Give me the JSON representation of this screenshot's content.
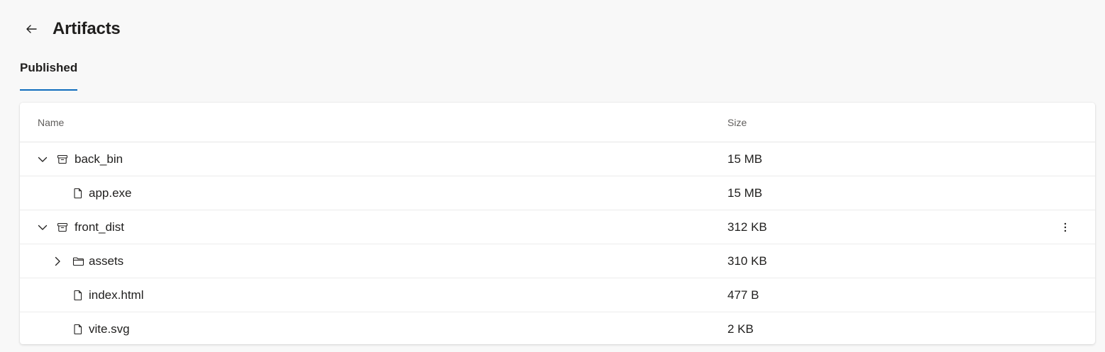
{
  "header": {
    "title": "Artifacts",
    "back_icon": "arrow-left-icon"
  },
  "tabs": [
    {
      "label": "Published",
      "active": true
    }
  ],
  "table": {
    "columns": {
      "name": "Name",
      "size": "Size"
    },
    "rows": [
      {
        "name": "back_bin",
        "size": "15 MB",
        "type": "archive",
        "level": 0,
        "expanded": true
      },
      {
        "name": "app.exe",
        "size": "15 MB",
        "type": "file",
        "level": 1
      },
      {
        "name": "front_dist",
        "size": "312 KB",
        "type": "archive",
        "level": 0,
        "expanded": true,
        "has_menu": true
      },
      {
        "name": "assets",
        "size": "310 KB",
        "type": "folder",
        "level": 1,
        "expanded": false
      },
      {
        "name": "index.html",
        "size": "477 B",
        "type": "file",
        "level": 1
      },
      {
        "name": "vite.svg",
        "size": "2 KB",
        "type": "file",
        "level": 1
      }
    ]
  },
  "colors": {
    "accent": "#0f6cbd",
    "background": "#f8f8f8",
    "card": "#ffffff",
    "text": "#201f1e",
    "muted": "#605e5c"
  }
}
